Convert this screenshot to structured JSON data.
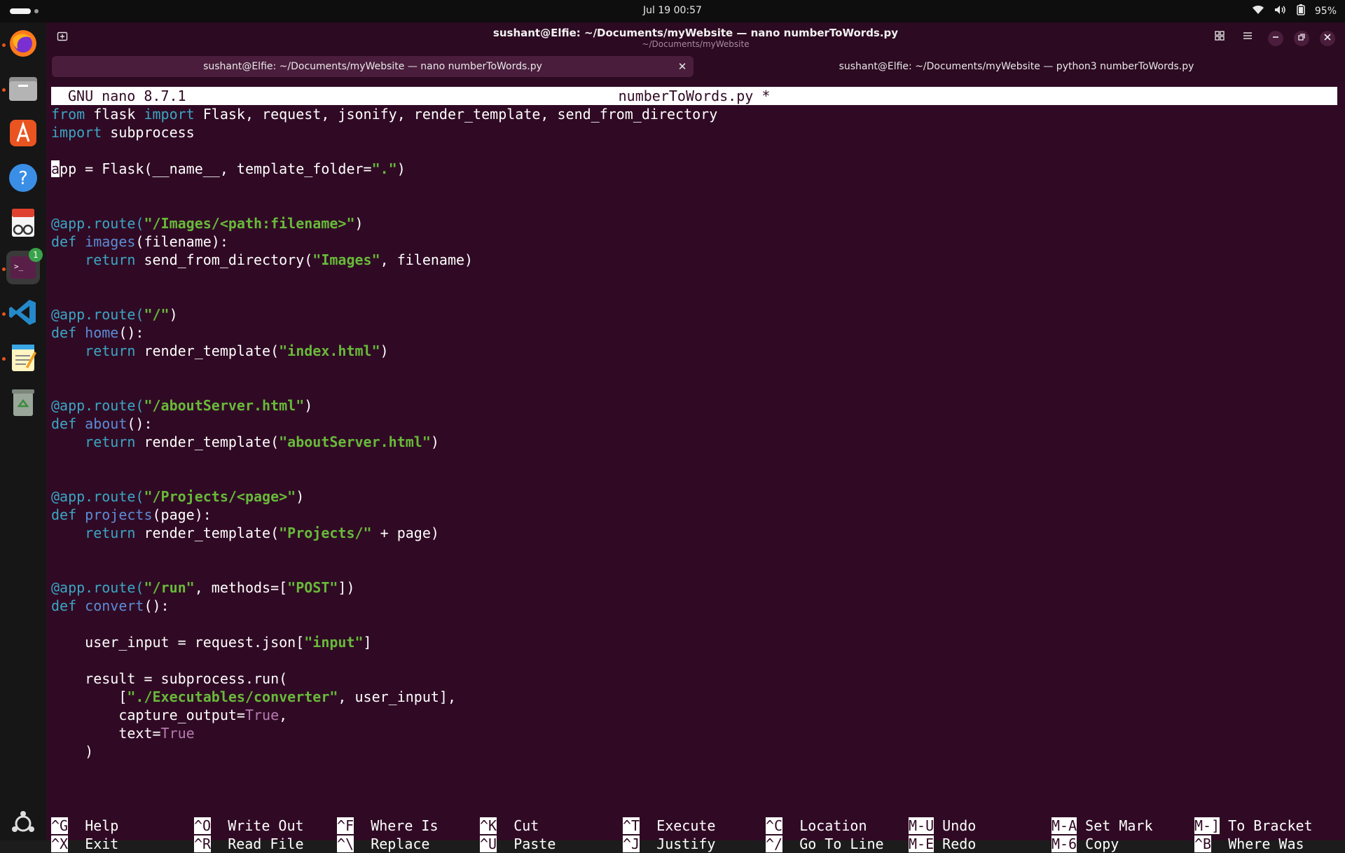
{
  "topbar": {
    "clock": "Jul 19  00:57",
    "battery": "95%",
    "icons": [
      "wifi-icon",
      "volume-icon",
      "battery-icon"
    ]
  },
  "dock": {
    "apps": [
      "firefox-icon",
      "files-icon",
      "app-center-icon",
      "help-icon",
      "document-viewer-icon",
      "terminal-icon",
      "vscode-icon",
      "text-editor-icon",
      "trash-icon",
      "show-apps-icon"
    ],
    "terminal_badge": "1"
  },
  "window": {
    "title": "sushant@Elfie: ~/Documents/myWebsite — nano numberToWords.py",
    "subtitle": "~/Documents/myWebsite"
  },
  "tabs": [
    {
      "label": "sushant@Elfie: ~/Documents/myWebsite — nano numberToWords.py",
      "active": true
    },
    {
      "label": "sushant@Elfie: ~/Documents/myWebsite — python3 numberToWords.py",
      "active": false
    }
  ],
  "nano": {
    "version": "GNU nano 8.7.1",
    "filename": "numberToWords.py *"
  },
  "code_lines": [
    [
      [
        "kw",
        "from"
      ],
      [
        "t",
        " flask "
      ],
      [
        "kw",
        "import"
      ],
      [
        "t",
        " Flask, request, jsonify, render_template, send_from_directory"
      ]
    ],
    [
      [
        "kw",
        "import"
      ],
      [
        "t",
        " subprocess"
      ]
    ],
    [],
    [
      [
        "cur",
        "a"
      ],
      [
        "t",
        "pp = Flask(__name__, template_folder="
      ],
      [
        "str",
        "\".\""
      ],
      [
        "t",
        ")"
      ]
    ],
    [],
    [],
    [
      [
        "dec",
        "@app.route("
      ],
      [
        "str",
        "\"/Images/<path:filename>\""
      ],
      [
        "t",
        ")"
      ]
    ],
    [
      [
        "kw",
        "def"
      ],
      [
        "t",
        " "
      ],
      [
        "fn",
        "images"
      ],
      [
        "t",
        "(filename):"
      ]
    ],
    [
      [
        "t",
        "    "
      ],
      [
        "kw",
        "return"
      ],
      [
        "t",
        " send_from_directory("
      ],
      [
        "str",
        "\"Images\""
      ],
      [
        "t",
        ", filename)"
      ]
    ],
    [],
    [],
    [
      [
        "dec",
        "@app.route("
      ],
      [
        "str",
        "\"/\""
      ],
      [
        "t",
        ")"
      ]
    ],
    [
      [
        "kw",
        "def"
      ],
      [
        "t",
        " "
      ],
      [
        "fn",
        "home"
      ],
      [
        "t",
        "():"
      ]
    ],
    [
      [
        "t",
        "    "
      ],
      [
        "kw",
        "return"
      ],
      [
        "t",
        " render_template("
      ],
      [
        "str",
        "\"index.html\""
      ],
      [
        "t",
        ")"
      ]
    ],
    [],
    [],
    [
      [
        "dec",
        "@app.route("
      ],
      [
        "str",
        "\"/aboutServer.html\""
      ],
      [
        "t",
        ")"
      ]
    ],
    [
      [
        "kw",
        "def"
      ],
      [
        "t",
        " "
      ],
      [
        "fn",
        "about"
      ],
      [
        "t",
        "():"
      ]
    ],
    [
      [
        "t",
        "    "
      ],
      [
        "kw",
        "return"
      ],
      [
        "t",
        " render_template("
      ],
      [
        "str",
        "\"aboutServer.html\""
      ],
      [
        "t",
        ")"
      ]
    ],
    [],
    [],
    [
      [
        "dec",
        "@app.route("
      ],
      [
        "str",
        "\"/Projects/<page>\""
      ],
      [
        "t",
        ")"
      ]
    ],
    [
      [
        "kw",
        "def"
      ],
      [
        "t",
        " "
      ],
      [
        "fn",
        "projects"
      ],
      [
        "t",
        "(page):"
      ]
    ],
    [
      [
        "t",
        "    "
      ],
      [
        "kw",
        "return"
      ],
      [
        "t",
        " render_template("
      ],
      [
        "str",
        "\"Projects/\""
      ],
      [
        "t",
        " + page)"
      ]
    ],
    [],
    [],
    [
      [
        "dec",
        "@app.route("
      ],
      [
        "str",
        "\"/run\""
      ],
      [
        "t",
        ", methods=["
      ],
      [
        "str",
        "\"POST\""
      ],
      [
        "t",
        "])"
      ]
    ],
    [
      [
        "kw",
        "def"
      ],
      [
        "t",
        " "
      ],
      [
        "fn",
        "convert"
      ],
      [
        "t",
        "():"
      ]
    ],
    [],
    [
      [
        "t",
        "    user_input = request.json["
      ],
      [
        "str",
        "\"input\""
      ],
      [
        "t",
        "]"
      ]
    ],
    [],
    [
      [
        "t",
        "    result = subprocess.run("
      ]
    ],
    [
      [
        "t",
        "        ["
      ],
      [
        "str",
        "\"./Executables/converter\""
      ],
      [
        "t",
        ", user_input],"
      ]
    ],
    [
      [
        "t",
        "        capture_output="
      ],
      [
        "bool",
        "True"
      ],
      [
        "t",
        ","
      ]
    ],
    [
      [
        "t",
        "        text="
      ],
      [
        "bool",
        "True"
      ]
    ],
    [
      [
        "t",
        "    )"
      ]
    ]
  ],
  "shortcuts": [
    {
      "key": "^G",
      "label": "Help"
    },
    {
      "key": "^X",
      "label": "Exit"
    },
    {
      "key": "^O",
      "label": "Write Out"
    },
    {
      "key": "^R",
      "label": "Read File"
    },
    {
      "key": "^F",
      "label": "Where Is"
    },
    {
      "key": "^\\",
      "label": "Replace"
    },
    {
      "key": "^K",
      "label": "Cut"
    },
    {
      "key": "^U",
      "label": "Paste"
    },
    {
      "key": "^T",
      "label": "Execute"
    },
    {
      "key": "^J",
      "label": "Justify"
    },
    {
      "key": "^C",
      "label": "Location"
    },
    {
      "key": "^/",
      "label": "Go To Line"
    },
    {
      "key": "M-U",
      "label": "Undo"
    },
    {
      "key": "M-E",
      "label": "Redo"
    },
    {
      "key": "M-A",
      "label": "Set Mark"
    },
    {
      "key": "M-6",
      "label": "Copy"
    },
    {
      "key": "M-]",
      "label": "To Bracket"
    },
    {
      "key": "^B",
      "label": "Where Was"
    }
  ]
}
